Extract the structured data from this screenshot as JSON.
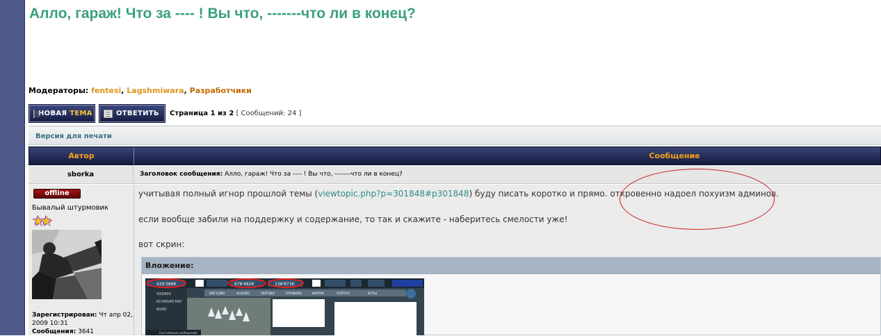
{
  "topic": {
    "title": "Алло, гараж! Что за ---- ! Вы что, -------что ли в конец?"
  },
  "moderators": {
    "label": "Модераторы:",
    "list": [
      "fentesi",
      "Lagshmiwara",
      "Разработчики"
    ]
  },
  "toolbar": {
    "new_topic_a": "НОВАЯ",
    "new_topic_b": "ТЕМА",
    "reply": "ОТВЕТИТЬ",
    "page_info": "Страница 1 из 2",
    "post_count": "[ Сообщений: 24 ]"
  },
  "print_link": "Версия для печати",
  "table_head": {
    "author": "Автор",
    "message": "Сообщение"
  },
  "post": {
    "author": "sborka",
    "subject_label": "Заголовок сообщения:",
    "subject": "Алло, гараж! Что за ---- ! Вы что, -------что ли в конец?",
    "status": "offline",
    "rank": "Бывалый штурмовик",
    "registered_label": "Зарегистрирован:",
    "registered": "Чт апр 02, 2009 10:31",
    "posts_label": "Сообщения:",
    "posts": "3641",
    "line1_before": "учитывая полный игнор прошлой темы (",
    "line1_link": "viewtopic.php?p=301848#p301848",
    "line1_after": ") буду писать коротко и прямо. откровенно надоел похуизм админов.",
    "line2": "если вообще забили на поддержку и содержание, то так и скажите - наберитесь смелости уже!",
    "line3": "вот скрин:",
    "attachment_label": "Вложение:"
  },
  "screenshot_strip": {
    "res1": "429'289К",
    "res2": "678'482К",
    "res3": "138'873К",
    "stat1": "500/800",
    "stat2": "65'000/65'000",
    "stat3": "60/60",
    "tabs": [
      "МАГАЗИН",
      "АНАЛИЗ",
      "РЕЙТИНГ",
      "ПРОФИЛЬ",
      "ФОРУМ",
      "ПОРТАЛ",
      "ИГРЫ"
    ],
    "footer": "Системные сообщения"
  }
}
